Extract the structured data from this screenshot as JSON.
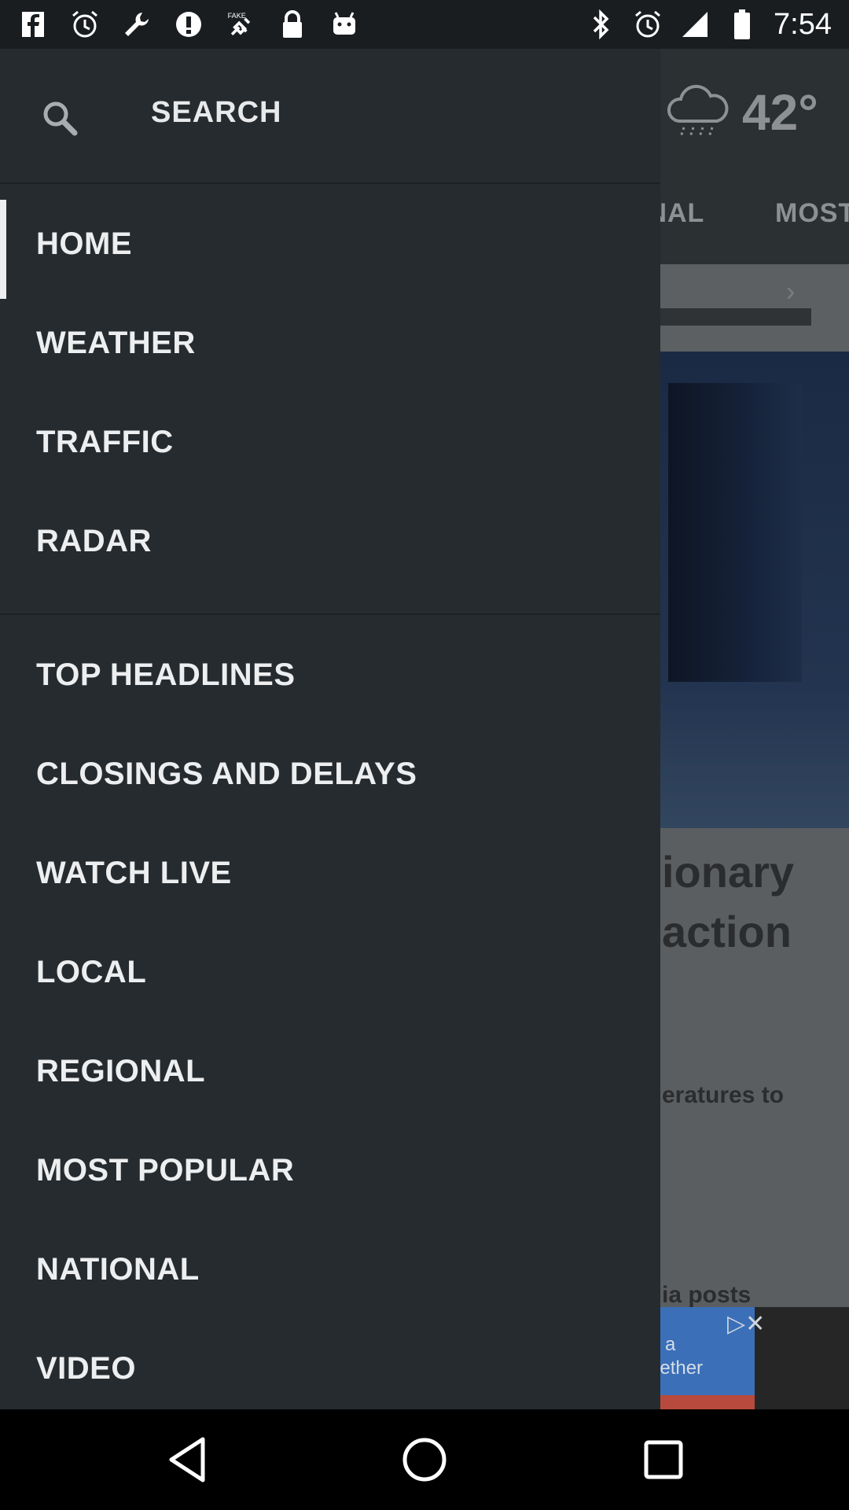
{
  "status_bar": {
    "time": "7:54",
    "left_icons": [
      "facebook-icon",
      "alarm-icon",
      "wrench-icon",
      "info-icon",
      "fake-gps-icon",
      "lock-icon",
      "android-icon"
    ],
    "right_icons": [
      "bluetooth-icon",
      "alarm-icon"
    ]
  },
  "drawer": {
    "search_label": "SEARCH",
    "items": [
      {
        "label": "HOME",
        "active": true
      },
      {
        "label": "WEATHER"
      },
      {
        "label": "TRAFFIC"
      },
      {
        "label": "RADAR"
      },
      {
        "label": "TOP HEADLINES"
      },
      {
        "label": "CLOSINGS AND DELAYS"
      },
      {
        "label": "WATCH LIVE"
      },
      {
        "label": "LOCAL"
      },
      {
        "label": "REGIONAL"
      },
      {
        "label": "MOST POPULAR"
      },
      {
        "label": "NATIONAL"
      },
      {
        "label": "VIDEO"
      }
    ]
  },
  "background": {
    "temperature": "42°",
    "tabs": [
      "ONAL",
      "MOST"
    ],
    "headline_line1": "ionary",
    "headline_line2": "action",
    "subtext": "eratures to",
    "subtext2": "ia posts",
    "ad_line1": "d a",
    "ad_line2": "gether"
  },
  "colors": {
    "drawer_bg": "#262b2f",
    "text": "#eceeef",
    "status_bar": "#1a1d20"
  }
}
